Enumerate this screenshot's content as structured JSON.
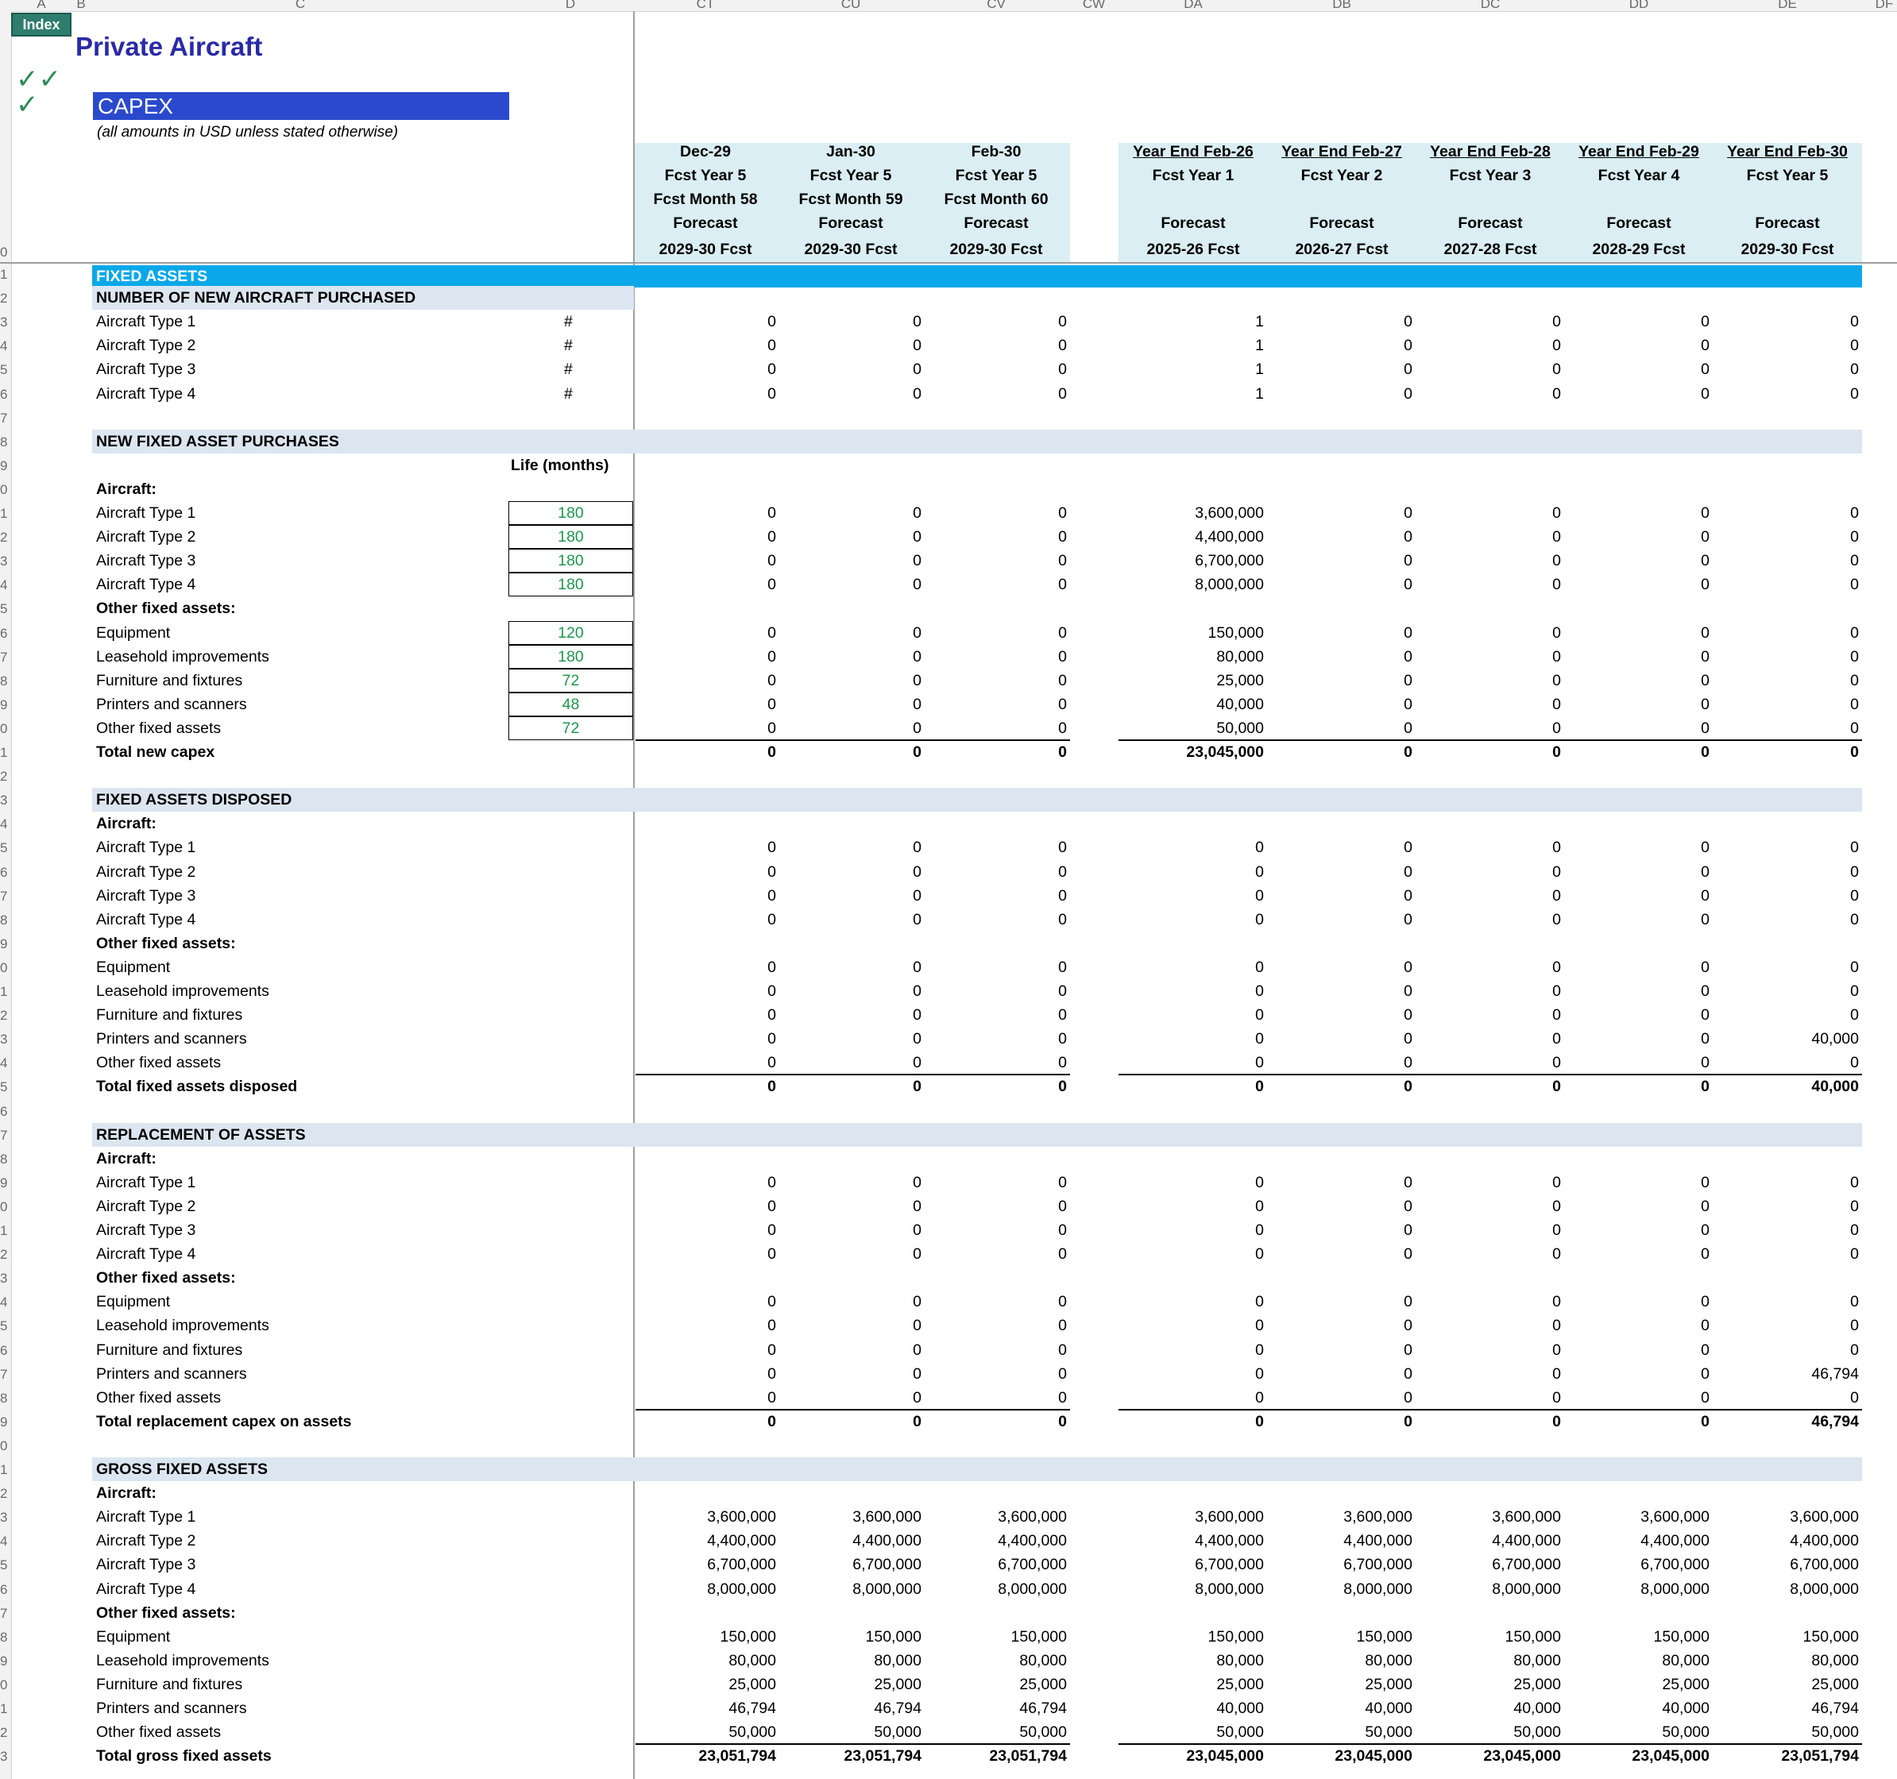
{
  "column_letters": [
    "A",
    "B",
    "C",
    "D",
    "CT",
    "CU",
    "CV",
    "CW",
    "DA",
    "DB",
    "DC",
    "DD",
    "DE",
    "DF"
  ],
  "index_button": "Index",
  "title": "Private Aircraft",
  "checkmarks": [
    "✓✓",
    "✓"
  ],
  "subtitle": "CAPEX",
  "note": "(all amounts in USD unless stated otherwise)",
  "life_header": "Life (months)",
  "periods": [
    {
      "line1": "Dec-29",
      "line2": "Fcst Year 5",
      "line3": "Fcst Month 58",
      "line4": "Forecast",
      "line5": "2029-30 Fcst"
    },
    {
      "line1": "Jan-30",
      "line2": "Fcst Year 5",
      "line3": "Fcst Month 59",
      "line4": "Forecast",
      "line5": "2029-30 Fcst"
    },
    {
      "line1": "Feb-30",
      "line2": "Fcst Year 5",
      "line3": "Fcst Month 60",
      "line4": "Forecast",
      "line5": "2029-30 Fcst"
    },
    {
      "line1": "Year End  Feb-26",
      "line2": "Fcst Year 1",
      "line3": "",
      "line4": "Forecast",
      "line5": "2025-26 Fcst"
    },
    {
      "line1": "Year End  Feb-27",
      "line2": "Fcst Year 2",
      "line3": "",
      "line4": "Forecast",
      "line5": "2026-27 Fcst"
    },
    {
      "line1": "Year End  Feb-28",
      "line2": "Fcst Year 3",
      "line3": "",
      "line4": "Forecast",
      "line5": "2027-28 Fcst"
    },
    {
      "line1": "Year End  Feb-29",
      "line2": "Fcst Year 4",
      "line3": "",
      "line4": "Forecast",
      "line5": "2028-29 Fcst"
    },
    {
      "line1": "Year End  Feb-30",
      "line2": "Fcst Year 5",
      "line3": "",
      "line4": "Forecast",
      "line5": "2029-30 Fcst"
    }
  ],
  "main_header": "FIXED ASSETS",
  "sections": [
    {
      "title": "NUMBER OF NEW AIRCRAFT PURCHASED",
      "rows": [
        {
          "label": "Aircraft Type 1",
          "unit": "#",
          "values": [
            "0",
            "0",
            "0",
            "1",
            "0",
            "0",
            "0",
            "0"
          ]
        },
        {
          "label": "Aircraft Type 2",
          "unit": "#",
          "values": [
            "0",
            "0",
            "0",
            "1",
            "0",
            "0",
            "0",
            "0"
          ]
        },
        {
          "label": "Aircraft Type 3",
          "unit": "#",
          "values": [
            "0",
            "0",
            "0",
            "1",
            "0",
            "0",
            "0",
            "0"
          ]
        },
        {
          "label": "Aircraft Type 4",
          "unit": "#",
          "values": [
            "0",
            "0",
            "0",
            "1",
            "0",
            "0",
            "0",
            "0"
          ]
        }
      ]
    },
    {
      "title": "NEW FIXED ASSET PURCHASES",
      "aircraft_label": "Aircraft:",
      "aircraft": [
        {
          "label": "Aircraft Type 1",
          "life": "180",
          "values": [
            "0",
            "0",
            "0",
            "3,600,000",
            "0",
            "0",
            "0",
            "0"
          ]
        },
        {
          "label": "Aircraft Type 2",
          "life": "180",
          "values": [
            "0",
            "0",
            "0",
            "4,400,000",
            "0",
            "0",
            "0",
            "0"
          ]
        },
        {
          "label": "Aircraft Type 3",
          "life": "180",
          "values": [
            "0",
            "0",
            "0",
            "6,700,000",
            "0",
            "0",
            "0",
            "0"
          ]
        },
        {
          "label": "Aircraft Type 4",
          "life": "180",
          "values": [
            "0",
            "0",
            "0",
            "8,000,000",
            "0",
            "0",
            "0",
            "0"
          ]
        }
      ],
      "other_label": "Other fixed assets:",
      "other": [
        {
          "label": "Equipment",
          "life": "120",
          "values": [
            "0",
            "0",
            "0",
            "150,000",
            "0",
            "0",
            "0",
            "0"
          ]
        },
        {
          "label": "Leasehold improvements",
          "life": "180",
          "values": [
            "0",
            "0",
            "0",
            "80,000",
            "0",
            "0",
            "0",
            "0"
          ]
        },
        {
          "label": "Furniture and fixtures",
          "life": "72",
          "values": [
            "0",
            "0",
            "0",
            "25,000",
            "0",
            "0",
            "0",
            "0"
          ]
        },
        {
          "label": "Printers and scanners",
          "life": "48",
          "values": [
            "0",
            "0",
            "0",
            "40,000",
            "0",
            "0",
            "0",
            "0"
          ]
        },
        {
          "label": "Other fixed assets",
          "life": "72",
          "values": [
            "0",
            "0",
            "0",
            "50,000",
            "0",
            "0",
            "0",
            "0"
          ]
        }
      ],
      "total": {
        "label": "Total new capex",
        "values": [
          "0",
          "0",
          "0",
          "23,045,000",
          "0",
          "0",
          "0",
          "0"
        ]
      }
    },
    {
      "title": "FIXED ASSETS DISPOSED",
      "aircraft_label": "Aircraft:",
      "aircraft": [
        {
          "label": "Aircraft Type 1",
          "values": [
            "0",
            "0",
            "0",
            "0",
            "0",
            "0",
            "0",
            "0"
          ]
        },
        {
          "label": "Aircraft Type 2",
          "values": [
            "0",
            "0",
            "0",
            "0",
            "0",
            "0",
            "0",
            "0"
          ]
        },
        {
          "label": "Aircraft Type 3",
          "values": [
            "0",
            "0",
            "0",
            "0",
            "0",
            "0",
            "0",
            "0"
          ]
        },
        {
          "label": "Aircraft Type 4",
          "values": [
            "0",
            "0",
            "0",
            "0",
            "0",
            "0",
            "0",
            "0"
          ]
        }
      ],
      "other_label": "Other fixed assets:",
      "other": [
        {
          "label": "Equipment",
          "values": [
            "0",
            "0",
            "0",
            "0",
            "0",
            "0",
            "0",
            "0"
          ]
        },
        {
          "label": "Leasehold improvements",
          "values": [
            "0",
            "0",
            "0",
            "0",
            "0",
            "0",
            "0",
            "0"
          ]
        },
        {
          "label": "Furniture and fixtures",
          "values": [
            "0",
            "0",
            "0",
            "0",
            "0",
            "0",
            "0",
            "0"
          ]
        },
        {
          "label": "Printers and scanners",
          "values": [
            "0",
            "0",
            "0",
            "0",
            "0",
            "0",
            "0",
            "40,000"
          ]
        },
        {
          "label": "Other fixed assets",
          "values": [
            "0",
            "0",
            "0",
            "0",
            "0",
            "0",
            "0",
            "0"
          ]
        }
      ],
      "total": {
        "label": "Total fixed assets disposed",
        "values": [
          "0",
          "0",
          "0",
          "0",
          "0",
          "0",
          "0",
          "40,000"
        ]
      }
    },
    {
      "title": "REPLACEMENT OF ASSETS",
      "aircraft_label": "Aircraft:",
      "aircraft": [
        {
          "label": "Aircraft Type 1",
          "values": [
            "0",
            "0",
            "0",
            "0",
            "0",
            "0",
            "0",
            "0"
          ]
        },
        {
          "label": "Aircraft Type 2",
          "values": [
            "0",
            "0",
            "0",
            "0",
            "0",
            "0",
            "0",
            "0"
          ]
        },
        {
          "label": "Aircraft Type 3",
          "values": [
            "0",
            "0",
            "0",
            "0",
            "0",
            "0",
            "0",
            "0"
          ]
        },
        {
          "label": "Aircraft Type 4",
          "values": [
            "0",
            "0",
            "0",
            "0",
            "0",
            "0",
            "0",
            "0"
          ]
        }
      ],
      "other_label": "Other fixed assets:",
      "other": [
        {
          "label": "Equipment",
          "values": [
            "0",
            "0",
            "0",
            "0",
            "0",
            "0",
            "0",
            "0"
          ]
        },
        {
          "label": "Leasehold improvements",
          "values": [
            "0",
            "0",
            "0",
            "0",
            "0",
            "0",
            "0",
            "0"
          ]
        },
        {
          "label": "Furniture and fixtures",
          "values": [
            "0",
            "0",
            "0",
            "0",
            "0",
            "0",
            "0",
            "0"
          ]
        },
        {
          "label": "Printers and scanners",
          "values": [
            "0",
            "0",
            "0",
            "0",
            "0",
            "0",
            "0",
            "46,794"
          ]
        },
        {
          "label": "Other fixed assets",
          "values": [
            "0",
            "0",
            "0",
            "0",
            "0",
            "0",
            "0",
            "0"
          ]
        }
      ],
      "total": {
        "label": "Total replacement capex on assets",
        "values": [
          "0",
          "0",
          "0",
          "0",
          "0",
          "0",
          "0",
          "46,794"
        ]
      }
    },
    {
      "title": "GROSS FIXED ASSETS",
      "aircraft_label": "Aircraft:",
      "aircraft": [
        {
          "label": "Aircraft Type 1",
          "values": [
            "3,600,000",
            "3,600,000",
            "3,600,000",
            "3,600,000",
            "3,600,000",
            "3,600,000",
            "3,600,000",
            "3,600,000"
          ]
        },
        {
          "label": "Aircraft Type 2",
          "values": [
            "4,400,000",
            "4,400,000",
            "4,400,000",
            "4,400,000",
            "4,400,000",
            "4,400,000",
            "4,400,000",
            "4,400,000"
          ]
        },
        {
          "label": "Aircraft Type 3",
          "values": [
            "6,700,000",
            "6,700,000",
            "6,700,000",
            "6,700,000",
            "6,700,000",
            "6,700,000",
            "6,700,000",
            "6,700,000"
          ]
        },
        {
          "label": "Aircraft Type 4",
          "values": [
            "8,000,000",
            "8,000,000",
            "8,000,000",
            "8,000,000",
            "8,000,000",
            "8,000,000",
            "8,000,000",
            "8,000,000"
          ]
        }
      ],
      "other_label": "Other fixed assets:",
      "other": [
        {
          "label": "Equipment",
          "values": [
            "150,000",
            "150,000",
            "150,000",
            "150,000",
            "150,000",
            "150,000",
            "150,000",
            "150,000"
          ]
        },
        {
          "label": "Leasehold improvements",
          "values": [
            "80,000",
            "80,000",
            "80,000",
            "80,000",
            "80,000",
            "80,000",
            "80,000",
            "80,000"
          ]
        },
        {
          "label": "Furniture and fixtures",
          "values": [
            "25,000",
            "25,000",
            "25,000",
            "25,000",
            "25,000",
            "25,000",
            "25,000",
            "25,000"
          ]
        },
        {
          "label": "Printers and scanners",
          "values": [
            "46,794",
            "46,794",
            "46,794",
            "40,000",
            "40,000",
            "40,000",
            "40,000",
            "46,794"
          ]
        },
        {
          "label": "Other fixed assets",
          "values": [
            "50,000",
            "50,000",
            "50,000",
            "50,000",
            "50,000",
            "50,000",
            "50,000",
            "50,000"
          ]
        }
      ],
      "total": {
        "label": "Total gross fixed assets",
        "values": [
          "23,051,794",
          "23,051,794",
          "23,051,794",
          "23,045,000",
          "23,045,000",
          "23,045,000",
          "23,045,000",
          "23,051,794"
        ]
      }
    }
  ]
}
